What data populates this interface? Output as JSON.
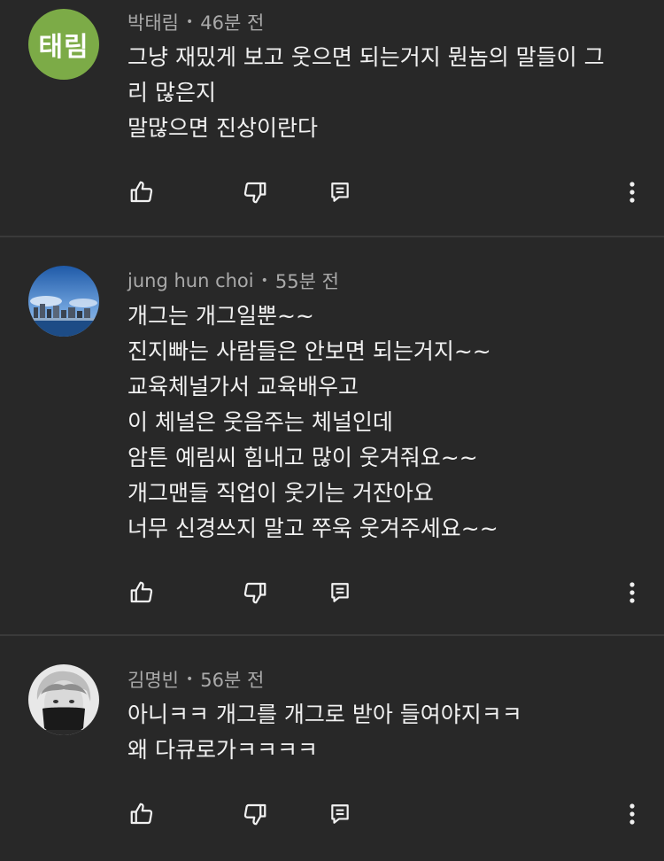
{
  "comments": [
    {
      "author": "박태림",
      "time": "46분 전",
      "avatar_initials": "태림",
      "avatar_color": "#7cab47",
      "lines": [
        "그냥 재밌게 보고 웃으면 되는거지 뭔놈의 말들이 그",
        "리 많은지",
        "말많으면 진상이란다"
      ]
    },
    {
      "author": "jung hun choi",
      "time": "55분 전",
      "avatar_image": "city-skyline-photo",
      "lines": [
        "개그는 개그일뿐~~",
        "진지빠는 사람들은 안보면 되는거지~~",
        "교육체널가서 교육배우고",
        "이 체널은 웃음주는 체널인데",
        "암튼 예림씨 힘내고 많이 웃겨줘요~~",
        "개그맨들 직업이 웃기는 거잔아요",
        "너무 신경쓰지 말고 쭈욱 웃겨주세요~~"
      ]
    },
    {
      "author": "김명빈",
      "time": "56분 전",
      "avatar_image": "masked-person-photo",
      "lines": [
        "아니ㅋㅋ 개그를 개그로 받아 들여야지ㅋㅋ",
        "왜 다큐로가ㅋㅋㅋㅋ"
      ]
    }
  ],
  "icons": {
    "like": "thumbs-up-icon",
    "dislike": "thumbs-down-icon",
    "reply": "reply-comment-icon",
    "more": "more-vertical-icon"
  },
  "separator": "•"
}
